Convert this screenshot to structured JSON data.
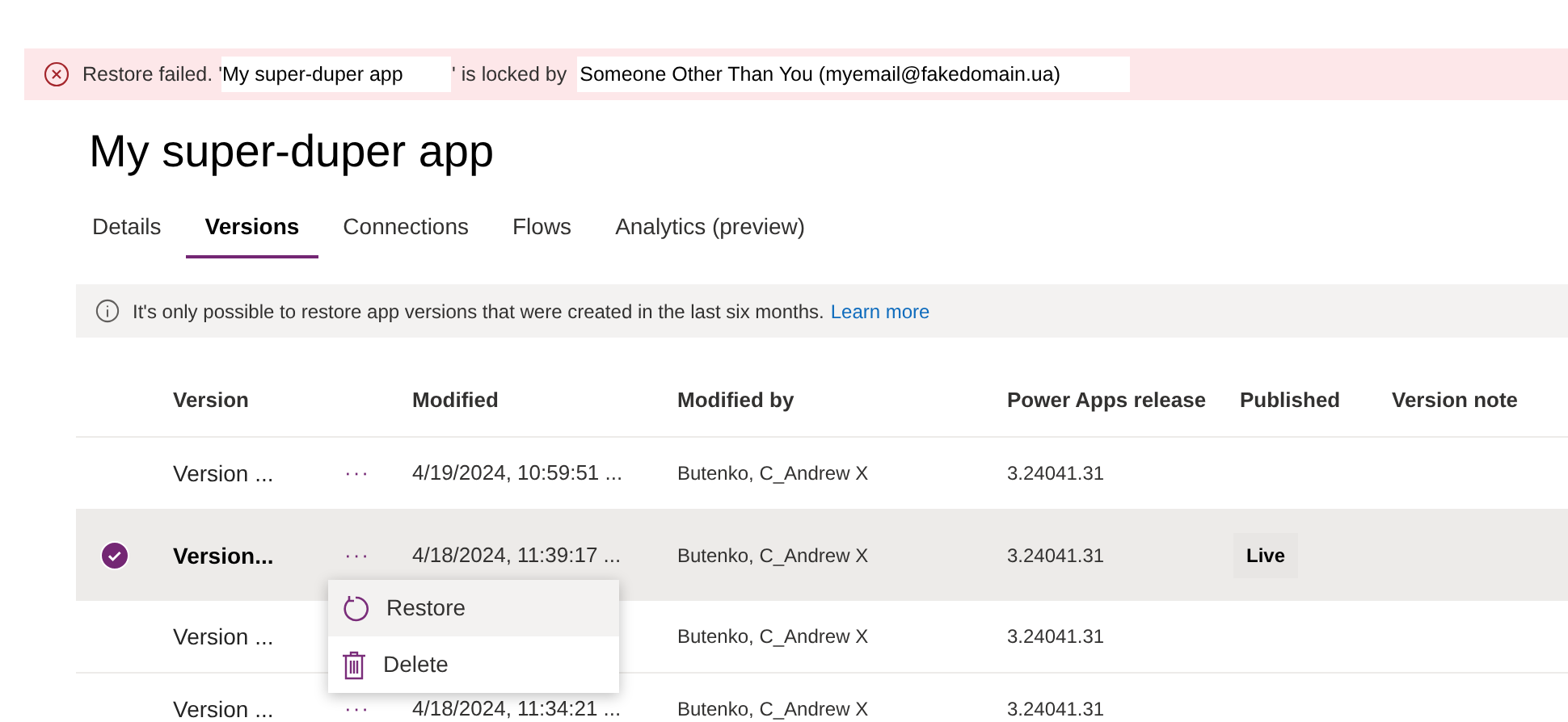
{
  "error_bar": {
    "prefix": "Restore failed. '",
    "app_name": "My super-duper app",
    "middle": "' is locked by",
    "locked_by": "Someone Other Than You (myemail@fakedomain.ua)"
  },
  "page_title": "My super-duper app",
  "tabs": [
    {
      "label": "Details",
      "selected": false
    },
    {
      "label": "Versions",
      "selected": true
    },
    {
      "label": "Connections",
      "selected": false
    },
    {
      "label": "Flows",
      "selected": false
    },
    {
      "label": "Analytics (preview)",
      "selected": false
    }
  ],
  "info_bar": {
    "text": "It's only possible to restore app versions that were created in the last six months.",
    "link": "Learn more"
  },
  "table": {
    "columns": [
      "Version",
      "Modified",
      "Modified by",
      "Power Apps release",
      "Published",
      "Version note"
    ],
    "rows": [
      {
        "version": "Version ...",
        "more": "···",
        "modified": "4/19/2024, 10:59:51 ...",
        "modified_by": "Butenko, C_Andrew X",
        "release": "3.24041.31",
        "selected": false
      },
      {
        "version": "Version...",
        "more": "···",
        "modified": "4/18/2024, 11:39:17 ...",
        "modified_by": "Butenko, C_Andrew X",
        "release": "3.24041.31",
        "published": "Live",
        "selected": true
      },
      {
        "version": "Version ...",
        "modified_by": "Butenko, C_Andrew X",
        "release": "3.24041.31",
        "selected": false
      },
      {
        "version": "Version ...",
        "more": "···",
        "modified": "4/18/2024, 11:34:21 ...",
        "modified_by": "Butenko, C_Andrew X",
        "release": "3.24041.31",
        "selected": false
      }
    ]
  },
  "context_menu": {
    "items": [
      {
        "kind": "restore",
        "label": "Restore",
        "selected": true
      },
      {
        "kind": "delete",
        "label": "Delete",
        "selected": false
      }
    ]
  }
}
